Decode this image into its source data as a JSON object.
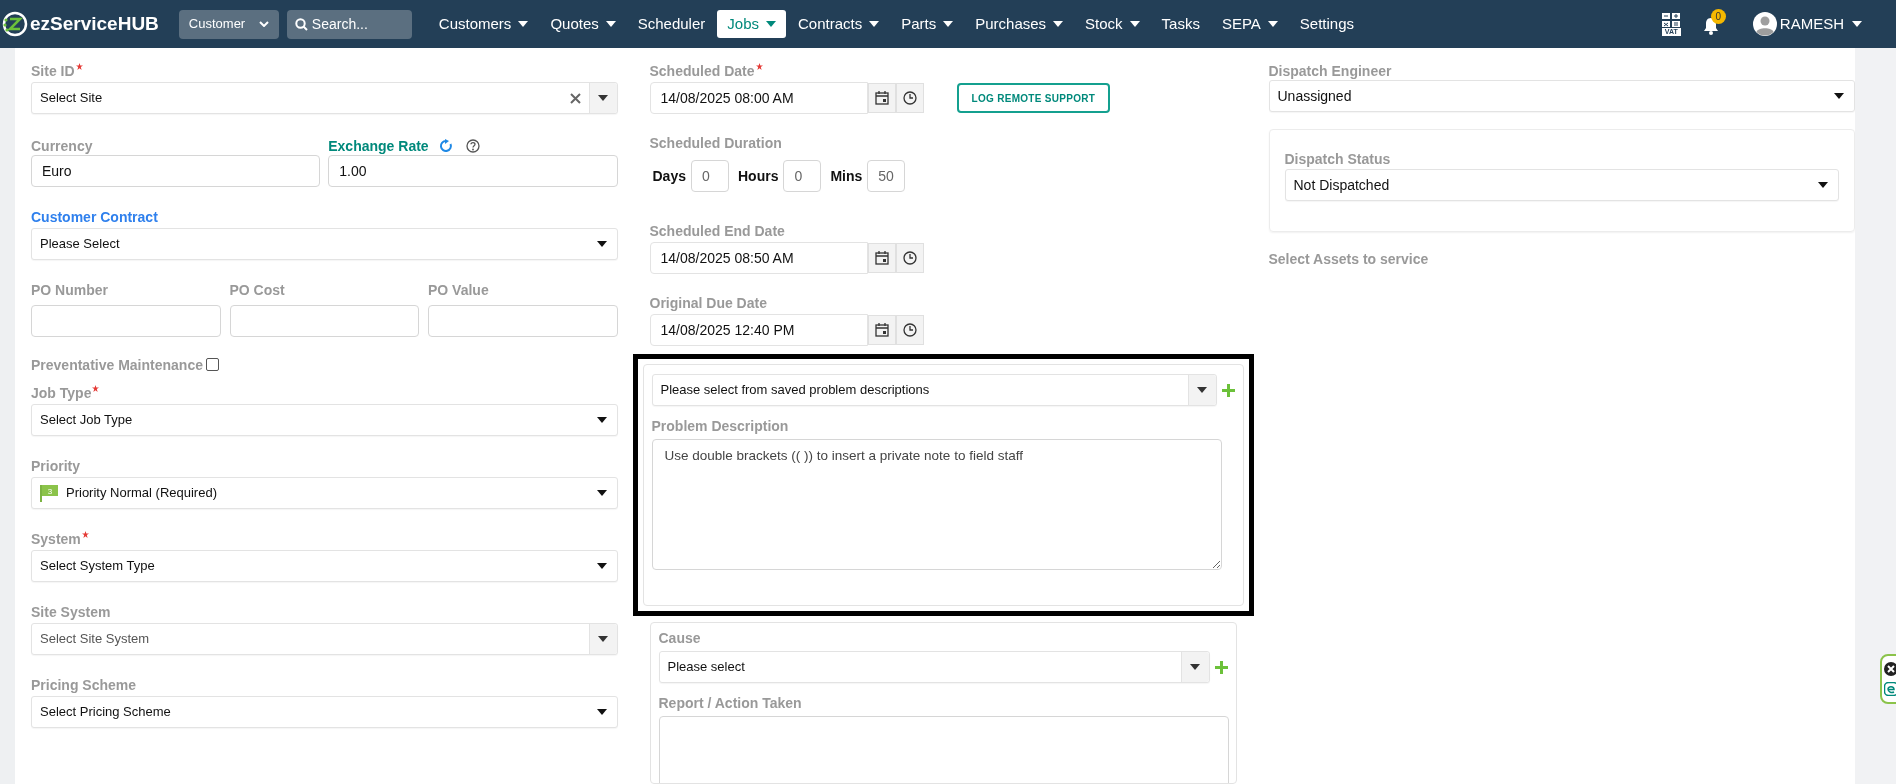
{
  "nav": {
    "brand": "ezServiceHUB",
    "scope_select": "Customer",
    "search": {
      "placeholder": "Search..."
    },
    "menu": [
      {
        "label": "Customers",
        "dropdown": true,
        "selected": false
      },
      {
        "label": "Quotes",
        "dropdown": true,
        "selected": false
      },
      {
        "label": "Scheduler",
        "dropdown": false,
        "selected": false
      },
      {
        "label": "Jobs",
        "dropdown": true,
        "selected": true
      },
      {
        "label": "Contracts",
        "dropdown": true,
        "selected": false
      },
      {
        "label": "Parts",
        "dropdown": true,
        "selected": false
      },
      {
        "label": "Purchases",
        "dropdown": true,
        "selected": false
      },
      {
        "label": "Stock",
        "dropdown": true,
        "selected": false
      },
      {
        "label": "Tasks",
        "dropdown": false,
        "selected": false
      },
      {
        "label": "SEPA",
        "dropdown": true,
        "selected": false
      },
      {
        "label": "Settings",
        "dropdown": false,
        "selected": false
      }
    ],
    "vat_label": "VAT",
    "notification_count": "0",
    "user": "RAMESH"
  },
  "left_column": [
    {
      "kind": "select",
      "label": "Site ID",
      "required": true,
      "value": "Select Site",
      "clear_button": true,
      "split_caret": true
    },
    {
      "kind": "pair",
      "items": [
        {
          "label": "Currency",
          "value": "Euro",
          "accent_label": false,
          "tools": false
        },
        {
          "label": "Exchange Rate",
          "value": "1.00",
          "accent_label": true,
          "tools": true
        }
      ]
    },
    {
      "kind": "select",
      "label": "Customer Contract",
      "link_label": true,
      "value": "Please Select"
    },
    {
      "kind": "triple",
      "items": [
        {
          "label": "PO Number"
        },
        {
          "label": "PO Cost"
        },
        {
          "label": "PO Value"
        }
      ]
    },
    {
      "kind": "checkbox",
      "label": "Preventative Maintenance",
      "checked": false
    },
    {
      "kind": "select",
      "label": "Job Type",
      "required": true,
      "value": "Select Job Type"
    },
    {
      "kind": "select",
      "label": "Priority",
      "value": "Priority Normal (Required)",
      "flag": "3"
    },
    {
      "kind": "select",
      "label": "System",
      "required": true,
      "value": "Select System Type"
    },
    {
      "kind": "select",
      "label": "Site System",
      "value": "Select Site System",
      "split_caret": true,
      "muted": true
    },
    {
      "kind": "select",
      "label": "Pricing Scheme",
      "value": "Select Pricing Scheme"
    }
  ],
  "middle_column": [
    {
      "kind": "datetime",
      "label": "Scheduled Date",
      "required": true,
      "value": "14/08/2025 08:00 AM",
      "action": "LOG REMOTE SUPPORT"
    },
    {
      "kind": "duration",
      "label": "Scheduled Duration",
      "parts": [
        {
          "unit": "Days",
          "value": "0"
        },
        {
          "unit": "Hours",
          "value": "0"
        },
        {
          "unit": "Mins",
          "value": "50"
        }
      ]
    },
    {
      "kind": "datetime",
      "label": "Scheduled End Date",
      "value": "14/08/2025 08:50 AM"
    },
    {
      "kind": "datetime",
      "label": "Original Due Date",
      "value": "14/08/2025 12:40 PM"
    }
  ],
  "problem_panel": {
    "highlighted": true,
    "saved_select": "Please select from saved problem descriptions",
    "label": "Problem Description",
    "placeholder": "Use double brackets (( )) to insert a private note to field staff"
  },
  "cause_panel": {
    "label": "Cause",
    "select": "Please select",
    "report_label": "Report / Action Taken"
  },
  "right_column": {
    "dispatch_engineer": {
      "label": "Dispatch Engineer",
      "value": "Unassigned"
    },
    "dispatch_status": {
      "label": "Dispatch Status",
      "value": "Not Dispatched"
    },
    "assets_label": "Select Assets to service"
  }
}
